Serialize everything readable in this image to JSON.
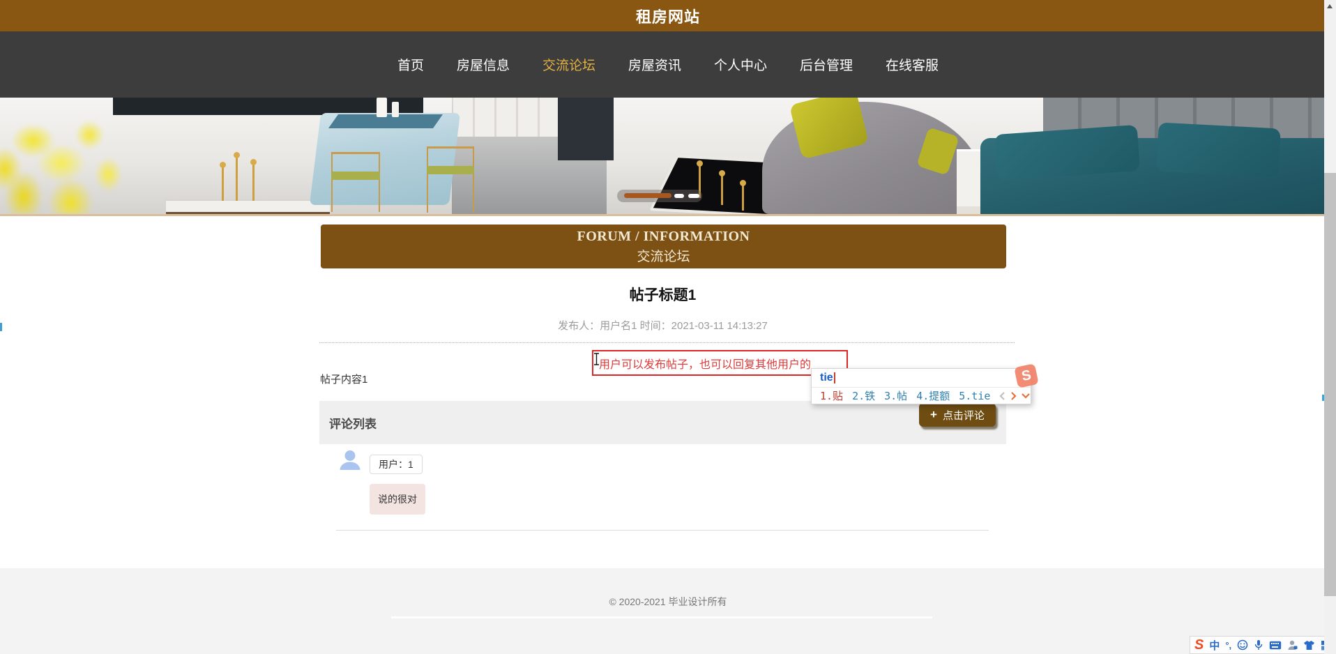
{
  "site": {
    "title": "租房网站"
  },
  "nav": {
    "items": [
      {
        "label": "首页"
      },
      {
        "label": "房屋信息"
      },
      {
        "label": "交流论坛"
      },
      {
        "label": "房屋资讯"
      },
      {
        "label": "个人中心"
      },
      {
        "label": "后台管理"
      },
      {
        "label": "在线客服"
      }
    ],
    "active": "交流论坛"
  },
  "banner": {
    "title_en": "FORUM / INFORMATION",
    "title_zh": "交流论坛"
  },
  "post": {
    "title": "帖子标题1",
    "meta": "发布人：用户名1 时间：2021-03-11 14:13:27",
    "content": "帖子内容1",
    "draft_text": "用户可以发布帖子，也可以回复其他用户的"
  },
  "comments": {
    "section_title": "评论列表",
    "plus": "+",
    "add_button_label": "点击评论",
    "items": [
      {
        "user": "用户：1",
        "text": "说的很对"
      }
    ]
  },
  "ime": {
    "input": "tie",
    "candidates": [
      "1.贴",
      "2.铁",
      "3.帖",
      "4.提额",
      "5.tie"
    ],
    "logo_letter": "S"
  },
  "taskbar": {
    "mode": "中",
    "punctuation": "°,",
    "logo_letter": "S"
  },
  "footer": {
    "copyright": "© 2020-2021 毕业设计所有"
  },
  "colors": {
    "header_brown": "#8a5713",
    "banner_brown": "#7d5013",
    "button_brown": "#6f4d12",
    "nav_bg": "#3d3d3d",
    "nav_active_gold": "#e5b143",
    "alert_red": "#df2424",
    "ime_blue": "#1a5cc8",
    "candidate_red": "#bf3a2b",
    "candidate_blue": "#2d7fae",
    "sogou_orange": "#f04a23"
  }
}
